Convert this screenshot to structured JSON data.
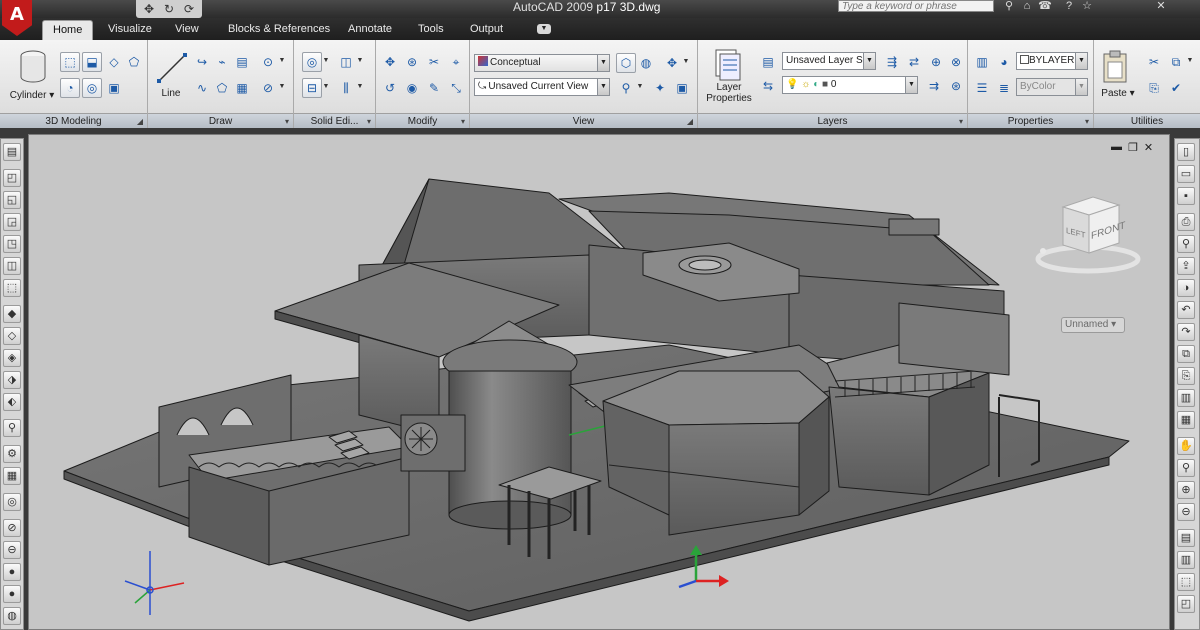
{
  "titlebar": {
    "app_letter": "A",
    "title_prefix": "AutoCAD 2009",
    "title_file": "p17 3D.dwg",
    "search_placeholder": "Type a keyword or phrase",
    "icons": [
      "binoculars-icon",
      "star-icon",
      "help-icon"
    ]
  },
  "qat": [
    "pan-icon",
    "orbit-icon",
    "free-orbit-icon"
  ],
  "tabs": [
    {
      "label": "Home",
      "active": true
    },
    {
      "label": "Visualize"
    },
    {
      "label": "View"
    },
    {
      "label": "Blocks & References"
    },
    {
      "label": "Annotate"
    },
    {
      "label": "Tools"
    },
    {
      "label": "Output"
    }
  ],
  "panels": {
    "modeling": {
      "title": "3D Modeling",
      "big_label": "Cylinder"
    },
    "draw": {
      "title": "Draw",
      "big_label": "Line"
    },
    "solid": {
      "title": "Solid Edi..."
    },
    "modify": {
      "title": "Modify"
    },
    "view": {
      "title": "View",
      "visual_style": "Conceptual",
      "named_view": "Unsaved Current View"
    },
    "layers": {
      "title": "Layers",
      "big_label": "Layer Properties",
      "layer_state": "Unsaved Layer State",
      "current_layer": "0"
    },
    "properties": {
      "title": "Properties",
      "color": "BYLAYER",
      "linetype": "ByColor"
    },
    "utilities": {
      "title": "Utilities",
      "big_label": "Paste"
    }
  },
  "viewport": {
    "viewcube_faces": [
      "LEFT",
      "FRONT"
    ],
    "named_view": "Unnamed",
    "background": "#c6c6c6"
  },
  "colors": {
    "accent": "#c21b1b",
    "ribbon": "#e4e4e4",
    "model": "#6f6f6f"
  }
}
